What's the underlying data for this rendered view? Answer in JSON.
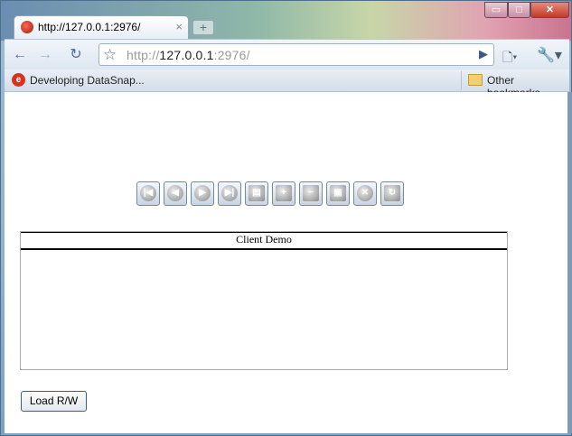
{
  "browser": {
    "tab_title": "http://127.0.0.1:2976/",
    "tab_close": "×",
    "new_tab": "+",
    "window_controls": {
      "minimize": "▭",
      "maximize": "□",
      "close": "✕"
    },
    "nav": {
      "back": "←",
      "forward": "→",
      "reload": "↻",
      "star": "☆",
      "go": "▶",
      "page": "🗋▾",
      "tools": "🔧▾"
    },
    "url_scheme": "http://",
    "url_host": "127.0.0.1",
    "url_rest": ":2976/",
    "bookmarks": {
      "item_icon": "e",
      "item_label": "Developing DataSnap...",
      "other_label": "Other bookmarks"
    }
  },
  "page": {
    "db_navigator": [
      {
        "name": "first-record",
        "glyph": "|◀"
      },
      {
        "name": "prior-record",
        "glyph": "◀"
      },
      {
        "name": "next-record",
        "glyph": "▶"
      },
      {
        "name": "last-record",
        "glyph": "▶|"
      },
      {
        "name": "insert-record",
        "glyph": "▤"
      },
      {
        "name": "add-record",
        "glyph": "+"
      },
      {
        "name": "delete-record",
        "glyph": "−"
      },
      {
        "name": "post-record",
        "glyph": "▣"
      },
      {
        "name": "cancel-record",
        "glyph": "✕"
      },
      {
        "name": "refresh-records",
        "glyph": "↻"
      }
    ],
    "grid_title": "Client Demo",
    "load_button": "Load R/W"
  },
  "colors": {
    "accent": "#4a6fa0",
    "frame": "#7fa3c3"
  }
}
